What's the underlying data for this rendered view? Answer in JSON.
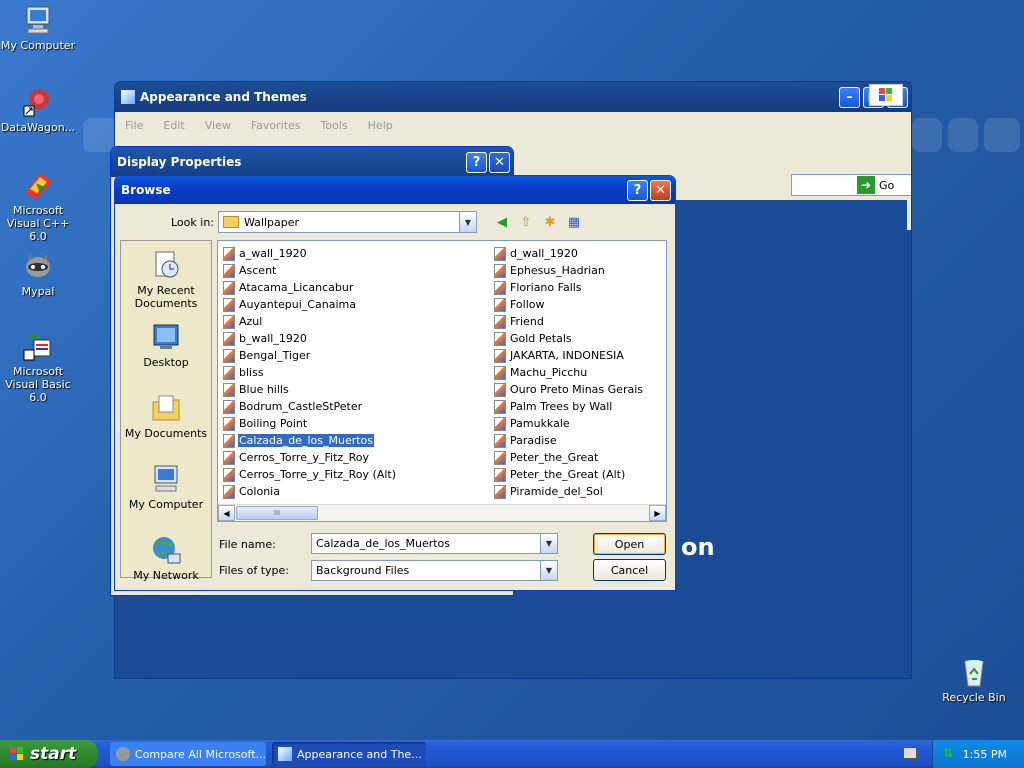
{
  "desktop": {
    "icons": [
      {
        "label": "My Computer"
      },
      {
        "label": "DataWagon..."
      },
      {
        "label": "Microsoft Visual C++ 6.0"
      },
      {
        "label": "Mypal"
      },
      {
        "label": "Microsoft Visual Basic 6.0"
      },
      {
        "label": "Recycle Bin"
      }
    ]
  },
  "appearance_window": {
    "title": "Appearance and Themes",
    "menu": [
      "File",
      "Edit",
      "View",
      "Favorites",
      "Tools",
      "Help"
    ],
    "go_label": "Go",
    "body_text": "on"
  },
  "display_window": {
    "title": "Display Properties"
  },
  "browse": {
    "title": "Browse",
    "look_in_label": "Look in:",
    "look_in_value": "Wallpaper",
    "places": [
      "My Recent Documents",
      "Desktop",
      "My Documents",
      "My Computer",
      "My Network"
    ],
    "files_col1": [
      "a_wall_1920",
      "Ascent",
      "Atacama_Licancabur",
      "Auyantepui_Canaima",
      "Azul",
      "b_wall_1920",
      "Bengal_Tiger",
      "bliss",
      "Blue hills",
      "Bodrum_CastleStPeter",
      "Boiling Point",
      "Calzada_de_los_Muertos",
      "Cerros_Torre_y_Fitz_Roy",
      "Cerros_Torre_y_Fitz_Roy (Alt)",
      "Colonia"
    ],
    "files_col2": [
      "d_wall_1920",
      "Ephesus_Hadrian",
      "Floriano Falls",
      "Follow",
      "Friend",
      "Gold Petals",
      "JAKARTA, INDONESIA",
      "Machu_Picchu",
      "Ouro Preto Minas Gerais",
      "Palm Trees by Wall",
      "Pamukkale",
      "Paradise",
      "Peter_the_Great",
      "Peter_the_Great (Alt)",
      "Piramide_del_Sol"
    ],
    "selected_file": "Calzada_de_los_Muertos",
    "file_name_label": "File name:",
    "file_name_value": "Calzada_de_los_Muertos",
    "file_type_label": "Files of type:",
    "file_type_value": "Background Files",
    "open_label": "Open",
    "cancel_label": "Cancel",
    "scroll_thumb": "III"
  },
  "taskbar": {
    "start_label": "start",
    "tasks": [
      "Compare All Microsoft...",
      "Appearance and The..."
    ],
    "clock": "1:55 PM"
  },
  "colors": {
    "xp_blue": "#0a58e0",
    "selection": "#316ac5",
    "start_green": "#2f8a2f"
  }
}
